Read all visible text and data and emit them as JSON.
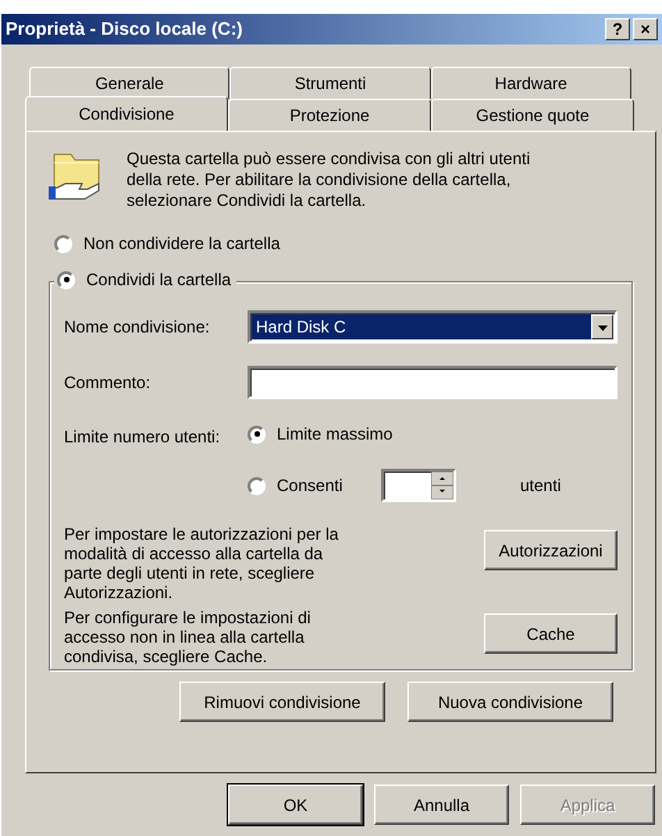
{
  "window": {
    "title": "Proprietà - Disco locale (C:)",
    "title_buttons": [
      "?",
      "×"
    ]
  },
  "tab_rows": [
    [
      {
        "label": "Generale",
        "selected": false
      },
      {
        "label": "Strumenti",
        "selected": false
      },
      {
        "label": "Hardware",
        "selected": false
      }
    ],
    [
      {
        "label": "Condivisione",
        "selected": true
      },
      {
        "label": "Protezione",
        "selected": false
      },
      {
        "label": "Gestione quote",
        "selected": false
      }
    ]
  ],
  "intro": {
    "text": "Questa cartella può essere condivisa con gli altri utenti della rete. Per abilitare la condivisione della cartella, selezionare Condividi la cartella."
  },
  "share_options": [
    {
      "label": "Non condividere la cartella",
      "selected": false
    },
    {
      "label": "Condividi la cartella",
      "selected": true
    }
  ],
  "share_name": {
    "label": "Nome condivisione:",
    "value": "Hard Disk C"
  },
  "comment": {
    "label": "Commento:"
  },
  "user_limit": {
    "label": "Limite numero utenti:",
    "options": [
      {
        "label": "Limite massimo",
        "selected": true
      },
      {
        "label": "Consenti",
        "selected": false
      }
    ],
    "unit": "utenti"
  },
  "permissions": {
    "text": "Per impostare le autorizzazioni per la modalità di accesso alla cartella da parte degli utenti in rete, scegliere Autorizzazioni.",
    "button": "Autorizzazioni"
  },
  "cache": {
    "text": "Per configurare le impostazioni di accesso non in linea alla cartella condivisa, scegliere Cache.",
    "button": "Cache"
  },
  "share_buttons": [
    "Rimuovi condivisione",
    "Nuova condivisione"
  ],
  "dialog_buttons": [
    {
      "label": "OK",
      "default": true,
      "disabled": false
    },
    {
      "label": "Annulla",
      "default": false,
      "disabled": false
    },
    {
      "label": "Applica",
      "default": false,
      "disabled": true
    }
  ]
}
